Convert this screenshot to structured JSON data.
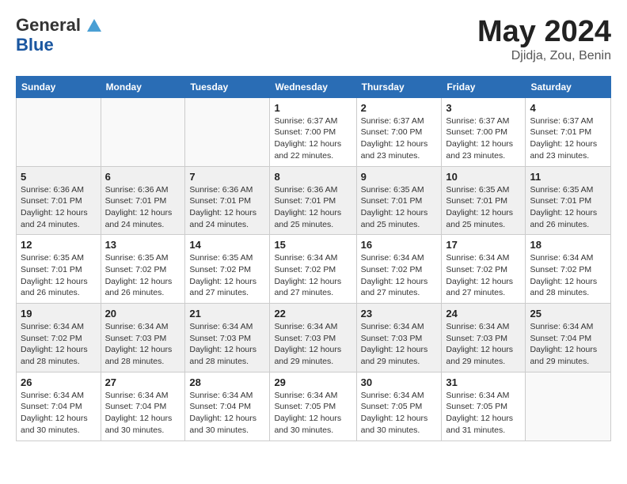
{
  "header": {
    "logo_general": "General",
    "logo_blue": "Blue",
    "title": "May 2024",
    "location": "Djidja, Zou, Benin"
  },
  "weekdays": [
    "Sunday",
    "Monday",
    "Tuesday",
    "Wednesday",
    "Thursday",
    "Friday",
    "Saturday"
  ],
  "weeks": [
    [
      {
        "day": "",
        "info": ""
      },
      {
        "day": "",
        "info": ""
      },
      {
        "day": "",
        "info": ""
      },
      {
        "day": "1",
        "info": "Sunrise: 6:37 AM\nSunset: 7:00 PM\nDaylight: 12 hours\nand 22 minutes."
      },
      {
        "day": "2",
        "info": "Sunrise: 6:37 AM\nSunset: 7:00 PM\nDaylight: 12 hours\nand 23 minutes."
      },
      {
        "day": "3",
        "info": "Sunrise: 6:37 AM\nSunset: 7:00 PM\nDaylight: 12 hours\nand 23 minutes."
      },
      {
        "day": "4",
        "info": "Sunrise: 6:37 AM\nSunset: 7:01 PM\nDaylight: 12 hours\nand 23 minutes."
      }
    ],
    [
      {
        "day": "5",
        "info": "Sunrise: 6:36 AM\nSunset: 7:01 PM\nDaylight: 12 hours\nand 24 minutes."
      },
      {
        "day": "6",
        "info": "Sunrise: 6:36 AM\nSunset: 7:01 PM\nDaylight: 12 hours\nand 24 minutes."
      },
      {
        "day": "7",
        "info": "Sunrise: 6:36 AM\nSunset: 7:01 PM\nDaylight: 12 hours\nand 24 minutes."
      },
      {
        "day": "8",
        "info": "Sunrise: 6:36 AM\nSunset: 7:01 PM\nDaylight: 12 hours\nand 25 minutes."
      },
      {
        "day": "9",
        "info": "Sunrise: 6:35 AM\nSunset: 7:01 PM\nDaylight: 12 hours\nand 25 minutes."
      },
      {
        "day": "10",
        "info": "Sunrise: 6:35 AM\nSunset: 7:01 PM\nDaylight: 12 hours\nand 25 minutes."
      },
      {
        "day": "11",
        "info": "Sunrise: 6:35 AM\nSunset: 7:01 PM\nDaylight: 12 hours\nand 26 minutes."
      }
    ],
    [
      {
        "day": "12",
        "info": "Sunrise: 6:35 AM\nSunset: 7:01 PM\nDaylight: 12 hours\nand 26 minutes."
      },
      {
        "day": "13",
        "info": "Sunrise: 6:35 AM\nSunset: 7:02 PM\nDaylight: 12 hours\nand 26 minutes."
      },
      {
        "day": "14",
        "info": "Sunrise: 6:35 AM\nSunset: 7:02 PM\nDaylight: 12 hours\nand 27 minutes."
      },
      {
        "day": "15",
        "info": "Sunrise: 6:34 AM\nSunset: 7:02 PM\nDaylight: 12 hours\nand 27 minutes."
      },
      {
        "day": "16",
        "info": "Sunrise: 6:34 AM\nSunset: 7:02 PM\nDaylight: 12 hours\nand 27 minutes."
      },
      {
        "day": "17",
        "info": "Sunrise: 6:34 AM\nSunset: 7:02 PM\nDaylight: 12 hours\nand 27 minutes."
      },
      {
        "day": "18",
        "info": "Sunrise: 6:34 AM\nSunset: 7:02 PM\nDaylight: 12 hours\nand 28 minutes."
      }
    ],
    [
      {
        "day": "19",
        "info": "Sunrise: 6:34 AM\nSunset: 7:02 PM\nDaylight: 12 hours\nand 28 minutes."
      },
      {
        "day": "20",
        "info": "Sunrise: 6:34 AM\nSunset: 7:03 PM\nDaylight: 12 hours\nand 28 minutes."
      },
      {
        "day": "21",
        "info": "Sunrise: 6:34 AM\nSunset: 7:03 PM\nDaylight: 12 hours\nand 28 minutes."
      },
      {
        "day": "22",
        "info": "Sunrise: 6:34 AM\nSunset: 7:03 PM\nDaylight: 12 hours\nand 29 minutes."
      },
      {
        "day": "23",
        "info": "Sunrise: 6:34 AM\nSunset: 7:03 PM\nDaylight: 12 hours\nand 29 minutes."
      },
      {
        "day": "24",
        "info": "Sunrise: 6:34 AM\nSunset: 7:03 PM\nDaylight: 12 hours\nand 29 minutes."
      },
      {
        "day": "25",
        "info": "Sunrise: 6:34 AM\nSunset: 7:04 PM\nDaylight: 12 hours\nand 29 minutes."
      }
    ],
    [
      {
        "day": "26",
        "info": "Sunrise: 6:34 AM\nSunset: 7:04 PM\nDaylight: 12 hours\nand 30 minutes."
      },
      {
        "day": "27",
        "info": "Sunrise: 6:34 AM\nSunset: 7:04 PM\nDaylight: 12 hours\nand 30 minutes."
      },
      {
        "day": "28",
        "info": "Sunrise: 6:34 AM\nSunset: 7:04 PM\nDaylight: 12 hours\nand 30 minutes."
      },
      {
        "day": "29",
        "info": "Sunrise: 6:34 AM\nSunset: 7:05 PM\nDaylight: 12 hours\nand 30 minutes."
      },
      {
        "day": "30",
        "info": "Sunrise: 6:34 AM\nSunset: 7:05 PM\nDaylight: 12 hours\nand 30 minutes."
      },
      {
        "day": "31",
        "info": "Sunrise: 6:34 AM\nSunset: 7:05 PM\nDaylight: 12 hours\nand 31 minutes."
      },
      {
        "day": "",
        "info": ""
      }
    ]
  ]
}
